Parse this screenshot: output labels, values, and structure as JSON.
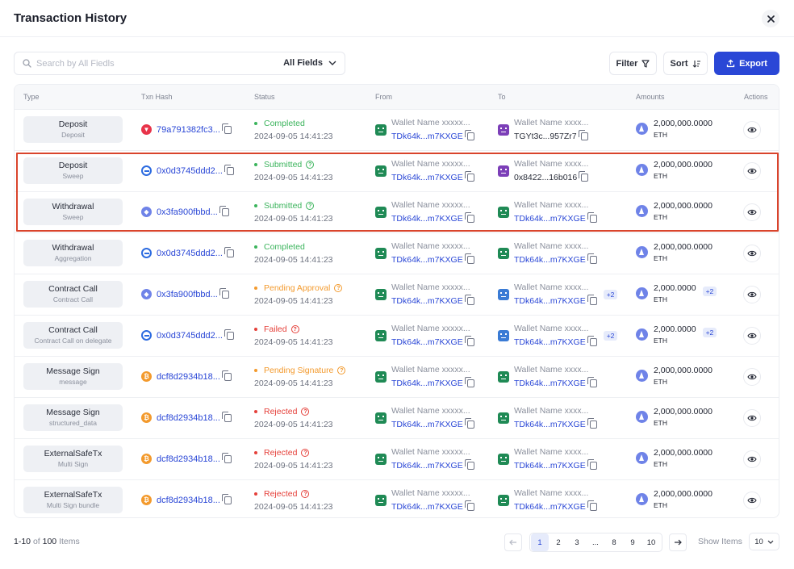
{
  "header": {
    "title": "Transaction History"
  },
  "toolbar": {
    "search_placeholder": "Search by All Fiedls",
    "fields_label": "All Fields",
    "filter_label": "Filter",
    "sort_label": "Sort",
    "export_label": "Export"
  },
  "columns": [
    "Type",
    "Txn Hash",
    "Status",
    "From",
    "To",
    "Amounts",
    "Actions"
  ],
  "colors": {
    "accent": "#2a47d6",
    "completed": "#3bb45c",
    "submitted": "#3bb45c",
    "pending": "#f39a2d",
    "failed": "#e5403a",
    "highlight_border": "#d9442c"
  },
  "rows": [
    {
      "type": "Deposit",
      "subtype": "Deposit",
      "coin": "tron-icon",
      "hash": "79a791382fc3...",
      "status": "Completed",
      "status_kind": "completed",
      "time": "2024-09-05 14:41:23",
      "from_name": "Wallet Name xxxxx...",
      "from_addr": "TDk64k...m7KXGE",
      "from_avatar": "green",
      "to_name": "Wallet Name xxxx...",
      "to_addr": "TGYt3c...957Zr7",
      "to_addr_style": "dark",
      "to_avatar": "purple",
      "to_extra": "",
      "amount": "2,000,000.0000",
      "unit": "ETH",
      "amount_extra": ""
    },
    {
      "type": "Deposit",
      "subtype": "Sweep",
      "coin": "ring-icon",
      "hash": "0x0d3745ddd2...",
      "status": "Submitted",
      "status_kind": "submitted",
      "time": "2024-09-05 14:41:23",
      "from_name": "Wallet Name xxxxx...",
      "from_addr": "TDk64k...m7KXGE",
      "from_avatar": "green",
      "to_name": "Wallet Name xxxx...",
      "to_addr": "0x8422...16b016",
      "to_addr_style": "dark",
      "to_avatar": "purple",
      "to_extra": "",
      "amount": "2,000,000.0000",
      "unit": "ETH",
      "amount_extra": ""
    },
    {
      "type": "Withdrawal",
      "subtype": "Sweep",
      "coin": "eth-icon",
      "hash": "0x3fa900fbbd...",
      "status": "Submitted",
      "status_kind": "submitted",
      "time": "2024-09-05 14:41:23",
      "from_name": "Wallet Name xxxxx...",
      "from_addr": "TDk64k...m7KXGE",
      "from_avatar": "green",
      "to_name": "Wallet Name xxxx...",
      "to_addr": "TDk64k...m7KXGE",
      "to_addr_style": "blue",
      "to_avatar": "green",
      "to_extra": "",
      "amount": "2,000,000.0000",
      "unit": "ETH",
      "amount_extra": ""
    },
    {
      "type": "Withdrawal",
      "subtype": "Aggregation",
      "coin": "ring-icon",
      "hash": "0x0d3745ddd2...",
      "status": "Completed",
      "status_kind": "completed",
      "time": "2024-09-05 14:41:23",
      "from_name": "Wallet Name xxxxx...",
      "from_addr": "TDk64k...m7KXGE",
      "from_avatar": "green",
      "to_name": "Wallet Name xxxx...",
      "to_addr": "TDk64k...m7KXGE",
      "to_addr_style": "blue",
      "to_avatar": "green",
      "to_extra": "",
      "amount": "2,000,000.0000",
      "unit": "ETH",
      "amount_extra": ""
    },
    {
      "type": "Contract Call",
      "subtype": "Contract Call",
      "coin": "eth-icon",
      "hash": "0x3fa900fbbd...",
      "status": "Pending Approval",
      "status_kind": "pending",
      "time": "2024-09-05 14:41:23",
      "from_name": "Wallet Name xxxxx...",
      "from_addr": "TDk64k...m7KXGE",
      "from_avatar": "green",
      "to_name": "Wallet Name xxxx...",
      "to_addr": "TDk64k...m7KXGE",
      "to_addr_style": "blue",
      "to_avatar": "multi",
      "to_extra": "+2",
      "amount": "2,000.0000",
      "unit": "ETH",
      "amount_extra": "+2"
    },
    {
      "type": "Contract Call",
      "subtype": "Contract Call on delegate",
      "coin": "ring-icon",
      "hash": "0x0d3745ddd2...",
      "status": "Failed",
      "status_kind": "failed",
      "time": "2024-09-05 14:41:23",
      "from_name": "Wallet Name xxxxx...",
      "from_addr": "TDk64k...m7KXGE",
      "from_avatar": "green",
      "to_name": "Wallet Name xxxx...",
      "to_addr": "TDk64k...m7KXGE",
      "to_addr_style": "blue",
      "to_avatar": "multi",
      "to_extra": "+2",
      "amount": "2,000.0000",
      "unit": "ETH",
      "amount_extra": "+2"
    },
    {
      "type": "Message Sign",
      "subtype": "message",
      "coin": "btc-icon",
      "hash": "dcf8d2934b18...",
      "status": "Pending Signature",
      "status_kind": "pending",
      "time": "2024-09-05 14:41:23",
      "from_name": "Wallet Name xxxxx...",
      "from_addr": "TDk64k...m7KXGE",
      "from_avatar": "green",
      "to_name": "Wallet Name xxxx...",
      "to_addr": "TDk64k...m7KXGE",
      "to_addr_style": "blue",
      "to_avatar": "green",
      "to_extra": "",
      "amount": "2,000,000.0000",
      "unit": "ETH",
      "amount_extra": ""
    },
    {
      "type": "Message Sign",
      "subtype": "structured_data",
      "coin": "btc-icon",
      "hash": "dcf8d2934b18...",
      "status": "Rejected",
      "status_kind": "failed",
      "time": "2024-09-05 14:41:23",
      "from_name": "Wallet Name xxxxx...",
      "from_addr": "TDk64k...m7KXGE",
      "from_avatar": "green",
      "to_name": "Wallet Name xxxx...",
      "to_addr": "TDk64k...m7KXGE",
      "to_addr_style": "blue",
      "to_avatar": "green",
      "to_extra": "",
      "amount": "2,000,000.0000",
      "unit": "ETH",
      "amount_extra": ""
    },
    {
      "type": "ExternalSafeTx",
      "subtype": "Multi Sign",
      "coin": "btc-icon",
      "hash": "dcf8d2934b18...",
      "status": "Rejected",
      "status_kind": "failed",
      "time": "2024-09-05 14:41:23",
      "from_name": "Wallet Name xxxxx...",
      "from_addr": "TDk64k...m7KXGE",
      "from_avatar": "green",
      "to_name": "Wallet Name xxxx...",
      "to_addr": "TDk64k...m7KXGE",
      "to_addr_style": "blue",
      "to_avatar": "green",
      "to_extra": "",
      "amount": "2,000,000.0000",
      "unit": "ETH",
      "amount_extra": ""
    },
    {
      "type": "ExternalSafeTx",
      "subtype": "Multi Sign bundle",
      "coin": "btc-icon",
      "hash": "dcf8d2934b18...",
      "status": "Rejected",
      "status_kind": "failed",
      "time": "2024-09-05 14:41:23",
      "from_name": "Wallet Name xxxxx...",
      "from_addr": "TDk64k...m7KXGE",
      "from_avatar": "green",
      "to_name": "Wallet Name xxxx...",
      "to_addr": "TDk64k...m7KXGE",
      "to_addr_style": "blue",
      "to_avatar": "green",
      "to_extra": "",
      "amount": "2,000,000.0000",
      "unit": "ETH",
      "amount_extra": ""
    }
  ],
  "footer": {
    "range": "1-10",
    "of_label": "of",
    "total": "100",
    "items_label": "Items",
    "pages": [
      "1",
      "2",
      "3",
      "...",
      "8",
      "9",
      "10"
    ],
    "current_page": "1",
    "show_items_label": "Show Items",
    "page_size": "10"
  }
}
